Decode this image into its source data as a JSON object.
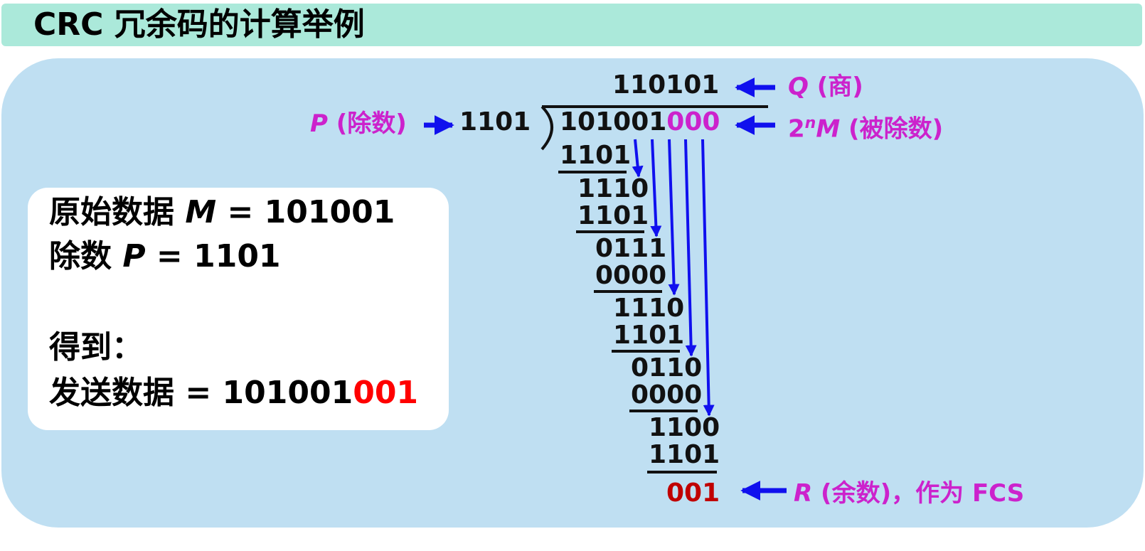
{
  "title": "CRC 冗余码的计算举例",
  "info": {
    "line1_prefix": "原始数据 ",
    "line1_var": "M",
    "line1_suffix": " = 101001",
    "line2_prefix": "除数 ",
    "line2_var": "P",
    "line2_suffix": " = 1101",
    "line3": "得到：",
    "line4_prefix": "发送数据 = 101001",
    "line4_red": "001"
  },
  "division": {
    "quotient": "110101",
    "divisor": "1101",
    "dividend_black": "101001",
    "dividend_appended": "000",
    "steps": [
      "1101",
      "1110",
      "1101",
      "0111",
      "0000",
      "1110",
      "1101",
      "0110",
      "0000",
      "1100",
      "1101"
    ],
    "remainder": "001"
  },
  "labels": {
    "quotient_var": "Q",
    "quotient_text": " (商)",
    "divisor_var": "P",
    "divisor_text": " (除数)",
    "dividend_prefix": "2",
    "dividend_sup": "n",
    "dividend_var": "M",
    "dividend_text": " (被除数)",
    "remainder_var": "R",
    "remainder_text": " (余数)，作为 FCS"
  },
  "colors": {
    "label": "#cc22cc",
    "arrow": "#1010ee",
    "remainder": "#c00000",
    "highlight": "#ff0000"
  }
}
